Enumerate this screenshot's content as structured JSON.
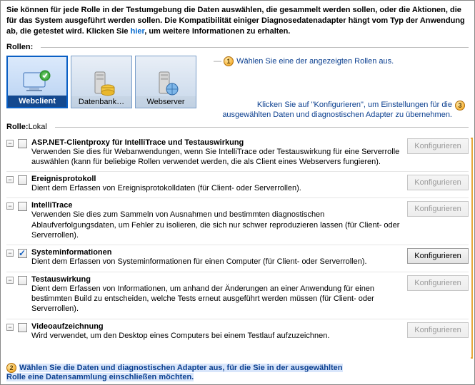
{
  "intro": {
    "text_before_link": "Sie können für jede Rolle in der Testumgebung die Daten auswählen, die gesammelt werden sollen, oder die Aktionen, die für das System ausgeführt werden sollen. Die Kompatibilität einiger Diagnosedatenadapter hängt vom Typ der Anwendung ab, die getestet wird. Klicken Sie ",
    "link": "hier",
    "text_after_link": ", um weitere Informationen zu erhalten."
  },
  "roles_heading": "Rollen:",
  "roles": [
    {
      "id": "webclient",
      "label": "Webclient",
      "selected": true,
      "icon": "monitor-globe-check"
    },
    {
      "id": "db",
      "label": "Datenbank…",
      "selected": false,
      "icon": "server-db"
    },
    {
      "id": "webserver",
      "label": "Webserver",
      "selected": false,
      "icon": "server-globe"
    }
  ],
  "callouts": {
    "c1": {
      "num": "1",
      "text": "Wählen Sie eine der angezeigten Rollen aus."
    },
    "c3": {
      "num": "3",
      "text": "Klicken Sie auf \"Konfigurieren\", um Einstellungen für die ausgewählten Daten und diagnostischen Adapter zu übernehmen."
    },
    "c2": {
      "num": "2",
      "text": "Wählen Sie die Daten und diagnostischen Adapter aus, für die Sie in der ausgewählten Rolle eine Datensammlung einschließen möchten."
    }
  },
  "role_sub": {
    "label": "Rolle:",
    "value": "Lokal"
  },
  "configure_label": "Konfigurieren",
  "adapters": [
    {
      "id": "aspnet",
      "title": "ASP.NET-Clientproxy für IntelliTrace und Testauswirkung",
      "desc": "Verwenden Sie dies für Webanwendungen, wenn Sie IntelliTrace oder Testauswirkung für eine Serverrolle auswählen (kann für beliebige Rollen verwendet werden, die als Client eines Webservers fungieren).",
      "checked": false,
      "cfg_enabled": false
    },
    {
      "id": "eventlog",
      "title": "Ereignisprotokoll",
      "desc": "Dient dem Erfassen von Ereignisprotokolldaten (für Client- oder Serverrollen).",
      "checked": false,
      "cfg_enabled": false
    },
    {
      "id": "intellitrace",
      "title": "IntelliTrace",
      "desc": "Verwenden Sie dies zum Sammeln von Ausnahmen und bestimmten diagnostischen Ablaufverfolgungsdaten, um Fehler zu isolieren, die sich nur schwer reproduzieren lassen (für Client- oder Serverrollen).",
      "checked": false,
      "cfg_enabled": false
    },
    {
      "id": "sysinfo",
      "title": "Systeminformationen",
      "desc": "Dient dem Erfassen von Systeminformationen für einen Computer (für Client- oder Serverrollen).",
      "checked": true,
      "cfg_enabled": true
    },
    {
      "id": "testimpact",
      "title": "Testauswirkung",
      "desc": "Dient dem Erfassen von Informationen, um anhand der Änderungen an einer Anwendung für einen bestimmten Build zu entscheiden, welche Tests erneut ausgeführt werden müssen (für Client- oder Serverrollen).",
      "checked": false,
      "cfg_enabled": false
    },
    {
      "id": "video",
      "title": "Videoaufzeichnung",
      "desc": "Wird verwendet, um den Desktop eines Computers bei einem Testlauf aufzuzeichnen.",
      "checked": false,
      "cfg_enabled": false
    }
  ]
}
